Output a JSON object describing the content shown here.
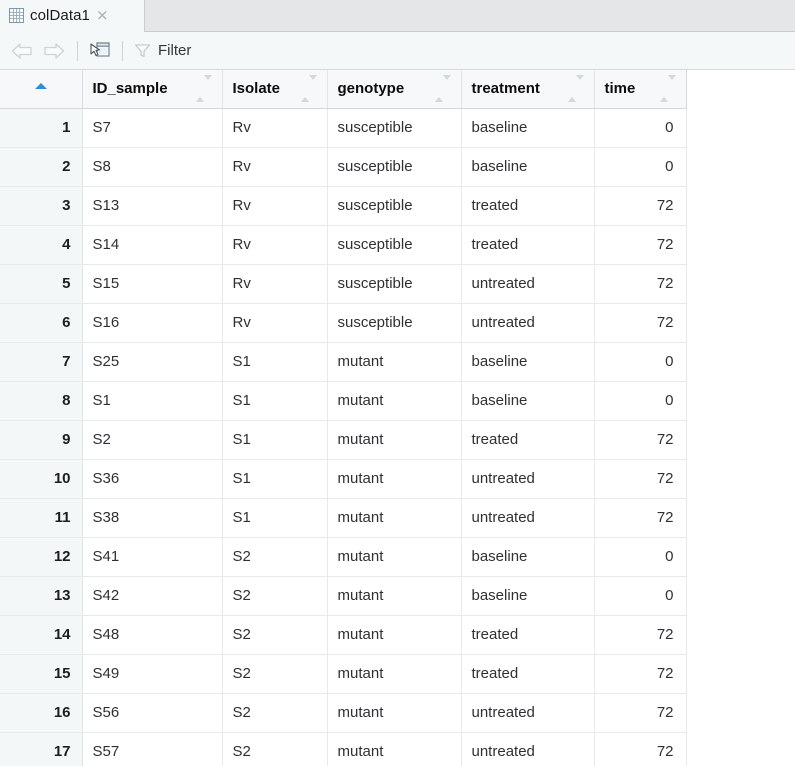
{
  "tab": {
    "title": "colData1",
    "icon": "table-grid-icon",
    "close_label": "×"
  },
  "toolbar": {
    "back_icon": "back-arrow-icon",
    "back_enabled": false,
    "forward_icon": "forward-arrow-icon",
    "forward_enabled": false,
    "export_icon": "open-in-new-window-icon",
    "filter_icon": "funnel-icon",
    "filter_label": "Filter"
  },
  "grid": {
    "sort_indicator": "ascending",
    "rownum_header": "",
    "columns": [
      {
        "label": "ID_sample",
        "align": "left"
      },
      {
        "label": "Isolate",
        "align": "left"
      },
      {
        "label": "genotype",
        "align": "left"
      },
      {
        "label": "treatment",
        "align": "left"
      },
      {
        "label": "time",
        "align": "right"
      }
    ],
    "rows": [
      {
        "n": "1",
        "cells": [
          "S7",
          "Rv",
          "susceptible",
          "baseline",
          "0"
        ]
      },
      {
        "n": "2",
        "cells": [
          "S8",
          "Rv",
          "susceptible",
          "baseline",
          "0"
        ]
      },
      {
        "n": "3",
        "cells": [
          "S13",
          "Rv",
          "susceptible",
          "treated",
          "72"
        ]
      },
      {
        "n": "4",
        "cells": [
          "S14",
          "Rv",
          "susceptible",
          "treated",
          "72"
        ]
      },
      {
        "n": "5",
        "cells": [
          "S15",
          "Rv",
          "susceptible",
          "untreated",
          "72"
        ]
      },
      {
        "n": "6",
        "cells": [
          "S16",
          "Rv",
          "susceptible",
          "untreated",
          "72"
        ]
      },
      {
        "n": "7",
        "cells": [
          "S25",
          "S1",
          "mutant",
          "baseline",
          "0"
        ]
      },
      {
        "n": "8",
        "cells": [
          "S1",
          "S1",
          "mutant",
          "baseline",
          "0"
        ]
      },
      {
        "n": "9",
        "cells": [
          "S2",
          "S1",
          "mutant",
          "treated",
          "72"
        ]
      },
      {
        "n": "10",
        "cells": [
          "S36",
          "S1",
          "mutant",
          "untreated",
          "72"
        ]
      },
      {
        "n": "11",
        "cells": [
          "S38",
          "S1",
          "mutant",
          "untreated",
          "72"
        ]
      },
      {
        "n": "12",
        "cells": [
          "S41",
          "S2",
          "mutant",
          "baseline",
          "0"
        ]
      },
      {
        "n": "13",
        "cells": [
          "S42",
          "S2",
          "mutant",
          "baseline",
          "0"
        ]
      },
      {
        "n": "14",
        "cells": [
          "S48",
          "S2",
          "mutant",
          "treated",
          "72"
        ]
      },
      {
        "n": "15",
        "cells": [
          "S49",
          "S2",
          "mutant",
          "treated",
          "72"
        ]
      },
      {
        "n": "16",
        "cells": [
          "S56",
          "S2",
          "mutant",
          "untreated",
          "72"
        ]
      },
      {
        "n": "17",
        "cells": [
          "S57",
          "S2",
          "mutant",
          "untreated",
          "72"
        ]
      }
    ]
  },
  "colors": {
    "tabstrip_bg": "#e4e6e8",
    "tab_active_bg": "#f5f8f9",
    "toolbar_bg": "#f5f8f9",
    "header_bg": "#f6f8f9",
    "rownum_bg": "#f4f7f8",
    "grid_line": "#e6eaed",
    "sort_accent": "#2b8fd8",
    "text": "#2e3033"
  }
}
